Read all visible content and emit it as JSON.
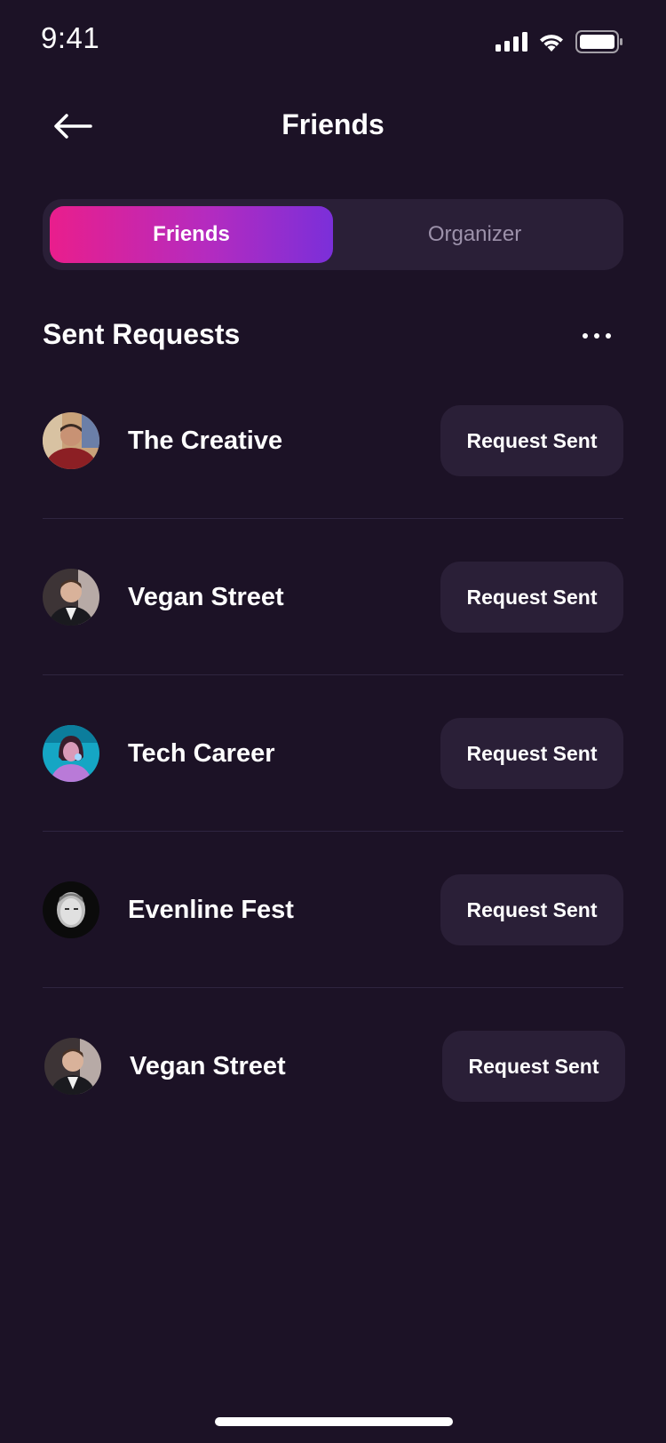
{
  "status_bar": {
    "time": "9:41",
    "icons": [
      "cellular-signal-icon",
      "wifi-icon",
      "battery-icon"
    ]
  },
  "header": {
    "title": "Friends",
    "back_icon": "arrow-left-icon"
  },
  "tabs": [
    {
      "label": "Friends",
      "active": true
    },
    {
      "label": "Organizer",
      "active": false
    }
  ],
  "section": {
    "title": "Sent Requests",
    "more_icon": "more-horizontal-icon"
  },
  "requests": [
    {
      "name": "The Creative",
      "button": "Request Sent",
      "avatar": "avatar-photo-man-red-sweater"
    },
    {
      "name": "Vegan Street",
      "button": "Request Sent",
      "avatar": "avatar-photo-man-suit"
    },
    {
      "name": "Tech Career",
      "button": "Request Sent",
      "avatar": "avatar-photo-woman-blue-light"
    },
    {
      "name": "Evenline Fest",
      "button": "Request Sent",
      "avatar": "avatar-photo-man-monochrome"
    },
    {
      "name": "Vegan Street",
      "button": "Request Sent",
      "avatar": "avatar-photo-man-suit"
    }
  ],
  "colors": {
    "background": "#1c1226",
    "surface": "#2a1f37",
    "accent_gradient_start": "#e91e8c",
    "accent_gradient_end": "#7b2fd9",
    "muted_text": "#9c91aa"
  }
}
